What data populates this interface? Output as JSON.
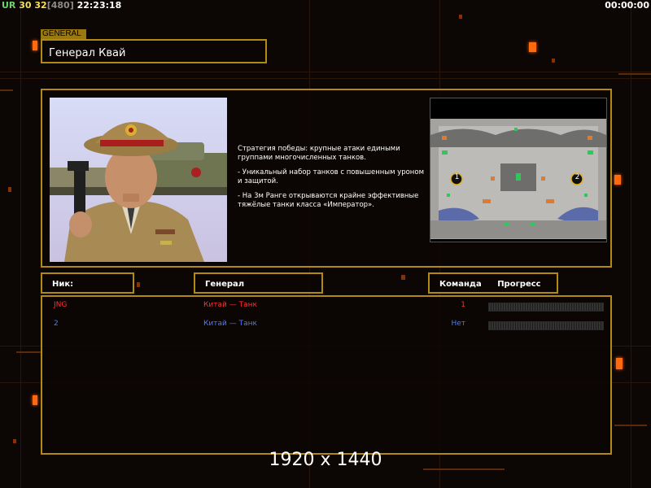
{
  "hud": {
    "ur": "UR",
    "val1": "30",
    "val2": "32",
    "val3": "[480]",
    "clock": "22:23:18",
    "timer": "00:00:00"
  },
  "general_panel": {
    "tag": "GENERAL",
    "name": "Генерал Квай"
  },
  "description": {
    "para1": "Стратегия победы: крупные атаки едиными группами многочисленных танков.",
    "para2": "- Уникальный набор танков с повышенным уроном и защитой.",
    "para3": "- На 3м Ранге открываются крайне эффективные тяжёлые танки класса «Император»."
  },
  "minimap": {
    "start1": "1",
    "start2": "2"
  },
  "table_headers": {
    "nick": "Ник:",
    "general": "Генерал",
    "team": "Команда",
    "progress": "Прогресс"
  },
  "players": [
    {
      "nick": "JNG",
      "general": "Китай — Танк",
      "team": "1",
      "color": "#ff3030",
      "progress": 0
    },
    {
      "nick": "2",
      "general": "Китай — Танк",
      "team": "Нет",
      "color": "#4a7aff",
      "progress": 0
    }
  ],
  "resolution": "1920 x 1440"
}
